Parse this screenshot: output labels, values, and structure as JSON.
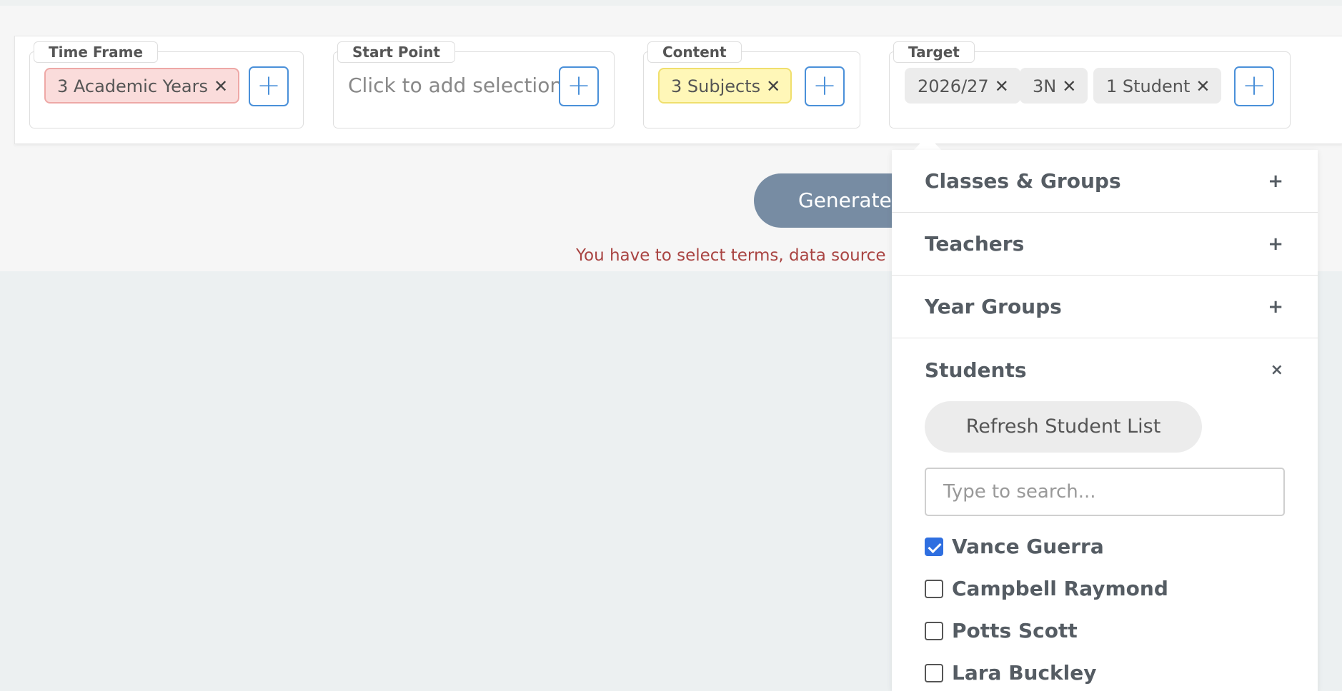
{
  "filters": {
    "time_frame": {
      "label": "Time Frame",
      "chips": [
        {
          "text": "3 Academic Years",
          "color": "#fadcdb"
        }
      ]
    },
    "start_point": {
      "label": "Start Point",
      "placeholder": "Click to add selection"
    },
    "content": {
      "label": "Content",
      "chips": [
        {
          "text": "3 Subjects",
          "color": "#fff7b8"
        }
      ]
    },
    "target": {
      "label": "Target",
      "chips": [
        {
          "text": "2026/27",
          "color": "#ececec"
        },
        {
          "text": "3N",
          "color": "#ececec"
        },
        {
          "text": "1 Student",
          "color": "#ececec"
        }
      ]
    },
    "add_icon": "plus-icon",
    "remove_icon": "close-icon",
    "remove_glyph": "✕",
    "add_glyph": "+"
  },
  "actions": {
    "generate_label": "Generate",
    "error_message": "You have to select terms, data source an"
  },
  "dropdown": {
    "sections": [
      {
        "title": "Classes & Groups",
        "toggle": "+"
      },
      {
        "title": "Teachers",
        "toggle": "+"
      },
      {
        "title": "Year Groups",
        "toggle": "+"
      }
    ],
    "students": {
      "title": "Students",
      "toggle": "×",
      "refresh_label": "Refresh Student List",
      "search_placeholder": "Type to search...",
      "list": [
        {
          "name": "Vance Guerra",
          "checked": true
        },
        {
          "name": "Campbell Raymond",
          "checked": false
        },
        {
          "name": "Potts Scott",
          "checked": false
        },
        {
          "name": "Lara Buckley",
          "checked": false
        }
      ]
    }
  },
  "colors": {
    "accent": "#4a90d9",
    "generate_button": "#778ca3",
    "error": "#a94442",
    "checkbox_checked": "#2f6fe0"
  }
}
